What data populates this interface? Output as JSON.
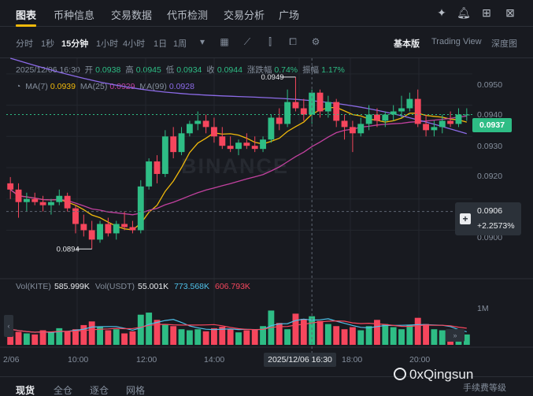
{
  "topnav": {
    "tabs": [
      "图表",
      "币种信息",
      "交易数据",
      "代币检测",
      "交易分析",
      "广场"
    ],
    "icons": [
      "sparkle-icon",
      "bell-icon",
      "grid-icon",
      "close-icon"
    ]
  },
  "toolbar": {
    "intervals": [
      "分时",
      "1秒",
      "15分钟",
      "1小时",
      "4小时",
      "1日",
      "1周"
    ],
    "active_interval": "15分钟",
    "views": [
      "基本版",
      "Trading View",
      "深度图"
    ],
    "active_view": "基本版"
  },
  "ohlc": {
    "datetime": "2025/12/06 16:30",
    "open_label": "开",
    "open": "0.0938",
    "high_label": "高",
    "high": "0.0945",
    "low_label": "低",
    "low": "0.0934",
    "close_label": "收",
    "close": "0.0944",
    "change_label": "涨跌幅",
    "change": "0.74%",
    "amp_label": "振幅",
    "amp": "1.17%"
  },
  "ma": {
    "ma7_label": "MA(7)",
    "ma7": "0.0939",
    "ma25_label": "MA(25)",
    "ma25": "0.0929",
    "ma99_label": "MA(99)",
    "ma99": "0.0928"
  },
  "price_axis": [
    "0.0950",
    "0.0940",
    "0.0930",
    "0.0920",
    "0.0900"
  ],
  "current_price": "0.0937",
  "cursor": {
    "price": "0.0906",
    "pct": "+2.2573%"
  },
  "annotations": {
    "high": "0.0949",
    "low": "0.0894"
  },
  "volume": {
    "label1": "Vol(KITE)",
    "val1": "585.999K",
    "label2": "Vol(USDT)",
    "val2": "55.001K",
    "ma1": "773.568K",
    "ma2": "606.793K",
    "axis_label": "1M"
  },
  "time_axis": [
    "2/06",
    "10:00",
    "12:00",
    "14:00",
    "18:00",
    "20:00"
  ],
  "time_highlight": "2025/12/06 16:30",
  "bottom_tabs": [
    "现货",
    "全仓",
    "逐仓",
    "网格"
  ],
  "watermark": "0xQingsun",
  "watermark2": "手续费等级",
  "brand": "BINANCE",
  "colors": {
    "up": "#2ebd85",
    "down": "#f6465d",
    "ma7": "#f0b90b",
    "ma25": "#c2419f",
    "ma99": "#8c6be8",
    "accent": "#f0b90b"
  },
  "chart_data": {
    "type": "candlestick",
    "interval": "15分钟",
    "candles": [
      [
        0.0915,
        0.0917,
        0.091,
        0.0913
      ],
      [
        0.0913,
        0.0915,
        0.0904,
        0.0909
      ],
      [
        0.0909,
        0.0912,
        0.0906,
        0.091
      ],
      [
        0.091,
        0.0912,
        0.0908,
        0.0909
      ],
      [
        0.0909,
        0.0911,
        0.0906,
        0.0908
      ],
      [
        0.0908,
        0.091,
        0.0905,
        0.0909
      ],
      [
        0.0909,
        0.0913,
        0.0908,
        0.0911
      ],
      [
        0.0911,
        0.0912,
        0.0906,
        0.0907
      ],
      [
        0.0907,
        0.0908,
        0.0899,
        0.0902
      ],
      [
        0.0902,
        0.0905,
        0.0898,
        0.09
      ],
      [
        0.09,
        0.0903,
        0.0894,
        0.0897
      ],
      [
        0.0897,
        0.0903,
        0.0896,
        0.0902
      ],
      [
        0.0902,
        0.0904,
        0.0898,
        0.0899
      ],
      [
        0.0899,
        0.0903,
        0.0897,
        0.0902
      ],
      [
        0.0902,
        0.0906,
        0.09,
        0.0901
      ],
      [
        0.0901,
        0.0903,
        0.0899,
        0.09
      ],
      [
        0.09,
        0.0916,
        0.0899,
        0.0914
      ],
      [
        0.0914,
        0.0923,
        0.0913,
        0.0922
      ],
      [
        0.0922,
        0.0924,
        0.0915,
        0.0918
      ],
      [
        0.0918,
        0.0932,
        0.0917,
        0.093
      ],
      [
        0.093,
        0.0933,
        0.0923,
        0.0925
      ],
      [
        0.0925,
        0.0933,
        0.0924,
        0.0931
      ],
      [
        0.0931,
        0.0935,
        0.093,
        0.0934
      ],
      [
        0.0934,
        0.0938,
        0.0932,
        0.0935
      ],
      [
        0.0935,
        0.0937,
        0.0931,
        0.0933
      ],
      [
        0.0933,
        0.0936,
        0.0928,
        0.093
      ],
      [
        0.093,
        0.0933,
        0.0926,
        0.0927
      ],
      [
        0.0927,
        0.093,
        0.0925,
        0.0926
      ],
      [
        0.0926,
        0.0929,
        0.0924,
        0.0928
      ],
      [
        0.0928,
        0.0931,
        0.0926,
        0.0927
      ],
      [
        0.0927,
        0.093,
        0.0925,
        0.0926
      ],
      [
        0.0926,
        0.093,
        0.0925,
        0.0929
      ],
      [
        0.0929,
        0.0937,
        0.0928,
        0.0936
      ],
      [
        0.0936,
        0.0939,
        0.0932,
        0.0934
      ],
      [
        0.0934,
        0.0945,
        0.0933,
        0.0941
      ],
      [
        0.0941,
        0.0949,
        0.0938,
        0.0939
      ],
      [
        0.0939,
        0.0942,
        0.0935,
        0.0937
      ],
      [
        0.0937,
        0.0945,
        0.0934,
        0.0944
      ],
      [
        0.0944,
        0.0945,
        0.0936,
        0.0938
      ],
      [
        0.0938,
        0.0943,
        0.0936,
        0.0941
      ],
      [
        0.0941,
        0.0942,
        0.0933,
        0.0935
      ],
      [
        0.0935,
        0.0937,
        0.0929,
        0.0933
      ],
      [
        0.0933,
        0.0935,
        0.0925,
        0.0931
      ],
      [
        0.0931,
        0.0936,
        0.093,
        0.0934
      ],
      [
        0.0934,
        0.094,
        0.0932,
        0.0937
      ],
      [
        0.0937,
        0.0939,
        0.0933,
        0.0935
      ],
      [
        0.0935,
        0.0938,
        0.0933,
        0.0937
      ],
      [
        0.0937,
        0.094,
        0.0935,
        0.0938
      ],
      [
        0.0938,
        0.0943,
        0.0936,
        0.0939
      ],
      [
        0.0939,
        0.0944,
        0.0938,
        0.0942
      ],
      [
        0.0942,
        0.0945,
        0.0933,
        0.0934
      ],
      [
        0.0934,
        0.0937,
        0.093,
        0.0932
      ],
      [
        0.0932,
        0.0935,
        0.093,
        0.0933
      ],
      [
        0.0933,
        0.0937,
        0.0931,
        0.0935
      ],
      [
        0.0935,
        0.0938,
        0.0933,
        0.0934
      ],
      [
        0.0934,
        0.0939,
        0.0933,
        0.0937
      ],
      [
        0.0937,
        0.0939,
        0.0935,
        0.0937
      ]
    ],
    "volumes": [
      0.3,
      0.25,
      0.22,
      0.2,
      0.28,
      0.24,
      0.32,
      0.26,
      0.3,
      0.38,
      0.45,
      0.35,
      0.28,
      0.3,
      0.22,
      0.26,
      0.58,
      0.62,
      0.48,
      0.4,
      0.36,
      0.3,
      0.28,
      0.3,
      0.26,
      0.32,
      0.35,
      0.3,
      0.24,
      0.28,
      0.3,
      0.36,
      0.66,
      0.42,
      0.3,
      0.6,
      0.5,
      0.55,
      0.46,
      0.4,
      0.36,
      0.3,
      0.34,
      0.28,
      0.36,
      0.48,
      0.4,
      0.34,
      0.3,
      0.38,
      0.52,
      0.4,
      0.3,
      0.28,
      0.26,
      0.22,
      0.2
    ],
    "ylim": [
      0.0885,
      0.0955
    ],
    "ma7": "0.0939",
    "ma25": "0.0929",
    "ma99": "0.0928"
  }
}
